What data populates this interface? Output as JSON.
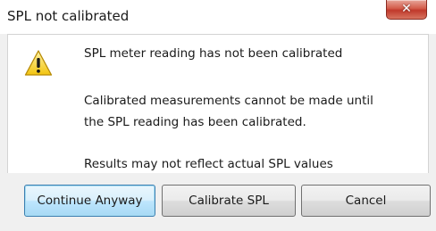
{
  "window": {
    "title": "SPL not calibrated",
    "close_icon": "close-x-icon"
  },
  "message": {
    "icon": "warning-icon",
    "heading": "SPL meter reading has not been calibrated",
    "body_line1": "Calibrated measurements cannot be made until",
    "body_line2": "the SPL reading has been calibrated.",
    "note": "Results may not reflect actual SPL values"
  },
  "buttons": {
    "continue_label": "Continue Anyway",
    "calibrate_label": "Calibrate SPL",
    "cancel_label": "Cancel"
  },
  "colors": {
    "close_button": "#c0392b",
    "default_button_border": "#3c7fb1",
    "warning_yellow": "#f7d330"
  }
}
